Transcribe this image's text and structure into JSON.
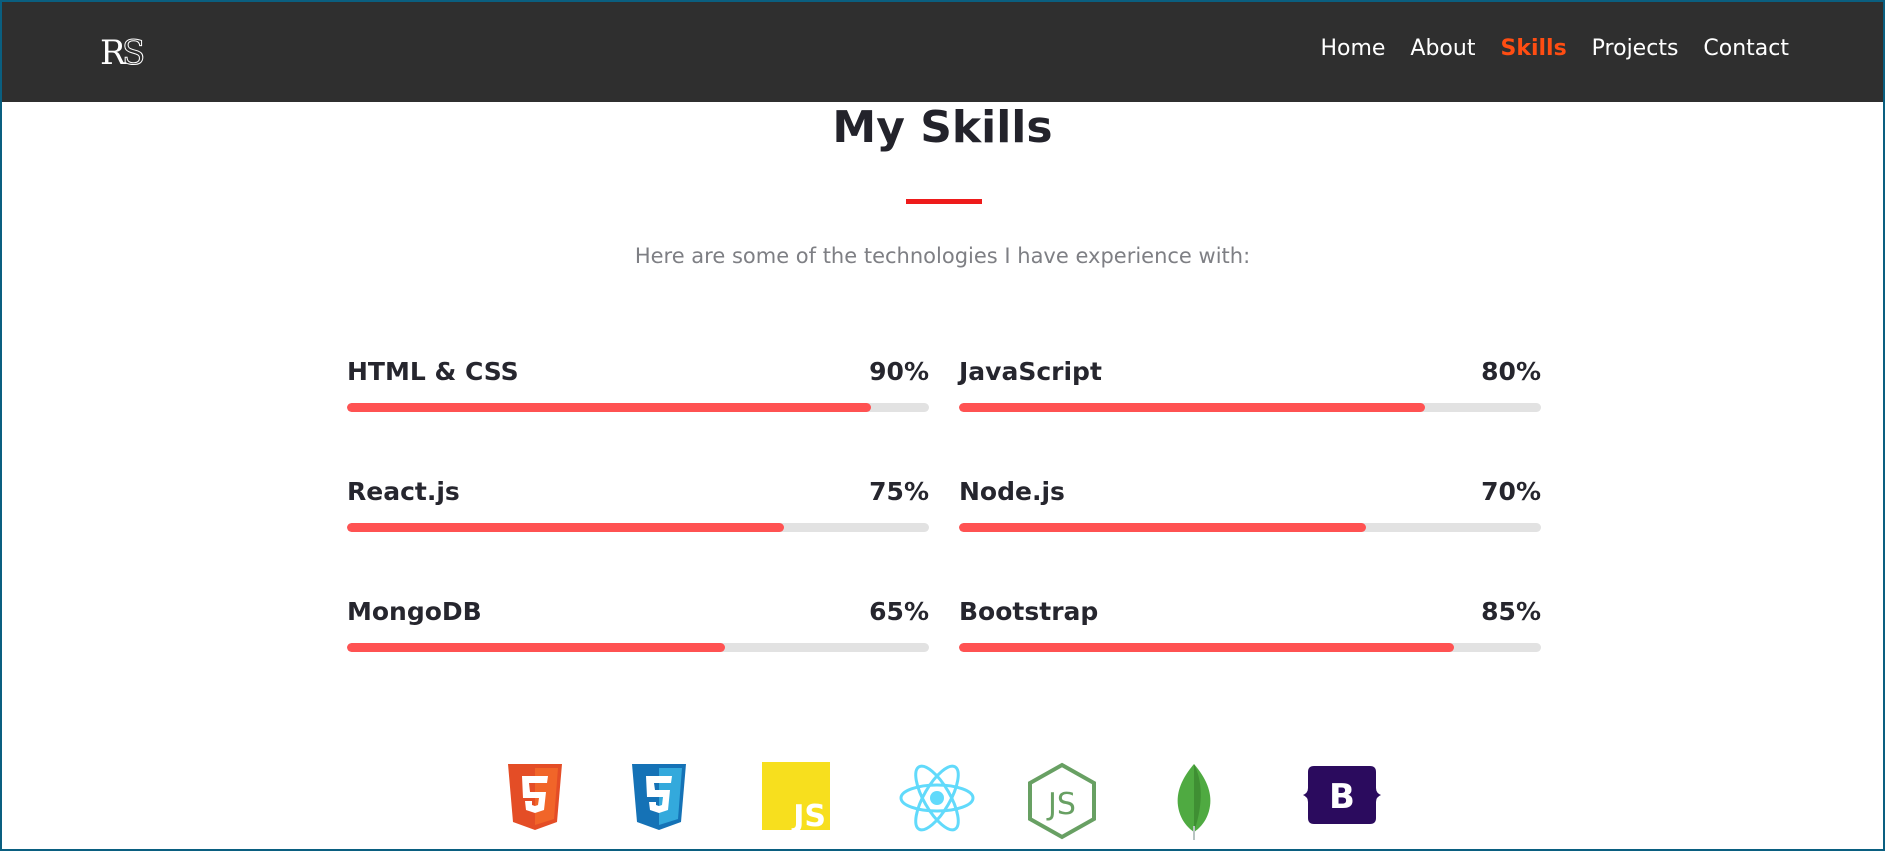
{
  "brand": {
    "logo_text": "RS"
  },
  "nav": {
    "items": [
      {
        "label": "Home",
        "active": false
      },
      {
        "label": "About",
        "active": false
      },
      {
        "label": "Skills",
        "active": true
      },
      {
        "label": "Projects",
        "active": false
      },
      {
        "label": "Contact",
        "active": false
      }
    ]
  },
  "section": {
    "title": "My Skills",
    "subtitle": "Here are some of the technologies I have experience with:"
  },
  "skills": [
    {
      "name": "HTML & CSS",
      "percent_label": "90%",
      "level": 0.9
    },
    {
      "name": "JavaScript",
      "percent_label": "80%",
      "level": 0.8
    },
    {
      "name": "React.js",
      "percent_label": "75%",
      "level": 0.75
    },
    {
      "name": "Node.js",
      "percent_label": "70%",
      "level": 0.7
    },
    {
      "name": "MongoDB",
      "percent_label": "65%",
      "level": 0.65
    },
    {
      "name": "Bootstrap",
      "percent_label": "85%",
      "level": 0.85
    }
  ],
  "tech_icons": [
    {
      "icon": "html5-icon"
    },
    {
      "icon": "css3-icon"
    },
    {
      "icon": "javascript-icon",
      "label": "JS"
    },
    {
      "icon": "react-icon"
    },
    {
      "icon": "nodejs-icon",
      "label": "JS"
    },
    {
      "icon": "mongodb-icon"
    },
    {
      "icon": "bootstrap-icon",
      "label": "B"
    }
  ],
  "colors": {
    "nav_bg": "#2f2f2f",
    "accent": "#ff4d12",
    "bar_fill": "#ff5252",
    "bar_track": "#e2e2e2",
    "underline": "#ee1b1b"
  }
}
